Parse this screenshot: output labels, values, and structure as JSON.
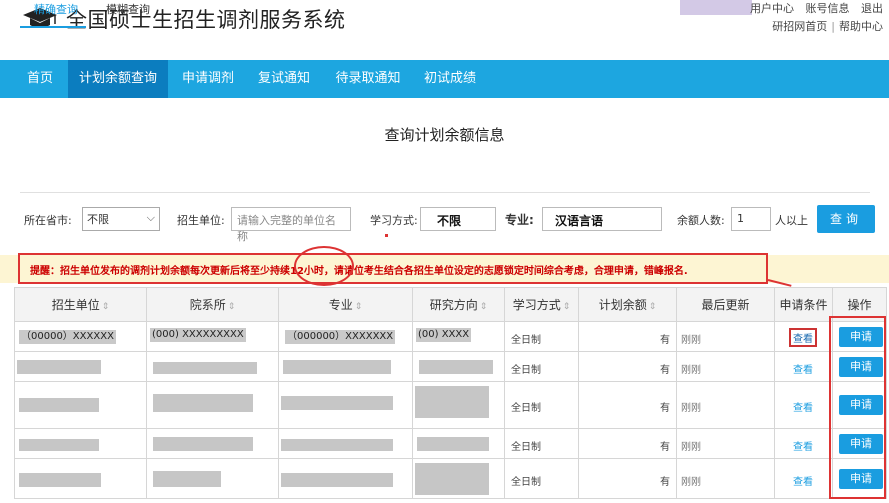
{
  "header": {
    "site_title": "全国硕士生招生调剂服务系统",
    "top_links": [
      "用户中心",
      "账号信息",
      "退出"
    ],
    "sub_links": [
      "研招网首页",
      "帮助中心"
    ],
    "sub_sep": "|",
    "logo_icon": "graduation-cap-icon"
  },
  "nav": {
    "items": [
      "首页",
      "计划余额查询",
      "申请调剂",
      "复试通知",
      "待录取通知",
      "初试成绩"
    ],
    "active_index": 1,
    "bg": "#1da6e0",
    "active_bg": "#0b7dbf"
  },
  "page_title": "查询计划余额信息",
  "tabs": [
    "精确查询",
    "模糊查询"
  ],
  "filters": {
    "province_label": "所在省市:",
    "province_value": "不限",
    "unit_label": "招生单位:",
    "unit_placeholder": "请输入完整的单位名称",
    "mode_label": "学习方式:",
    "mode_value": "不限",
    "major_label": "专业:",
    "major_value": "汉语言语",
    "remaining_label": "余额人数:",
    "remaining_value": "1",
    "remaining_suffix": "人以上",
    "query_button": "查询"
  },
  "notice": {
    "prefix": "提醒：招生单位发布的调剂计划余额每次更新后将至少",
    "highlight": "持续12小时",
    "suffix": "，请请位考生结合各招生单位设定的志愿锁定时间综合考虑，合理申请，错峰报名."
  },
  "table": {
    "sort_glyph": "⇕",
    "headers": [
      "招生单位",
      "院系所",
      "专业",
      "研究方向",
      "学习方式",
      "计划余额",
      "最后更新",
      "申请条件",
      "操作"
    ],
    "first_row": {
      "unit": "（00000）XXXXXX",
      "dept": "(000) XXXXXXXXX",
      "major": "（000000）XXXXXXX",
      "direction": "(00) XXXX"
    },
    "mode": "全日制",
    "remaining": "有",
    "updated": "刚刚",
    "view_label": "查看",
    "apply_label": "申请",
    "row_count": 5
  }
}
